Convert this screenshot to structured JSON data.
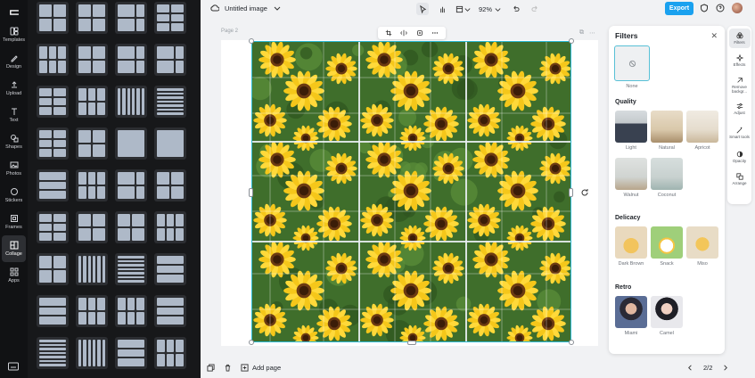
{
  "rail": {
    "items": [
      {
        "label": "Templates",
        "icon": "templates-icon"
      },
      {
        "label": "Design",
        "icon": "design-icon"
      },
      {
        "label": "Upload",
        "icon": "upload-icon"
      },
      {
        "label": "Text",
        "icon": "text-icon"
      },
      {
        "label": "Shapes",
        "icon": "shapes-icon"
      },
      {
        "label": "Photos",
        "icon": "photos-icon"
      },
      {
        "label": "Stickers",
        "icon": "stickers-icon"
      },
      {
        "label": "Frames",
        "icon": "frames-icon"
      },
      {
        "label": "Collage",
        "icon": "collage-icon"
      },
      {
        "label": "Apps",
        "icon": "apps-icon"
      }
    ],
    "active": "Collage"
  },
  "topbar": {
    "doc_title": "Untitled image",
    "zoom": "92%",
    "export_label": "Export"
  },
  "canvas": {
    "page_label": "Page 2"
  },
  "bottombar": {
    "add_page_label": "Add page",
    "page_indicator": "2/2"
  },
  "filters": {
    "title": "Filters",
    "none_label": "None",
    "sections": {
      "quality": {
        "title": "Quality",
        "items": [
          "Light",
          "Natural",
          "Apricot",
          "Walnut",
          "Coconut"
        ]
      },
      "delicacy": {
        "title": "Delicacy",
        "items": [
          "Dark Brown",
          "Snack",
          "Miso"
        ]
      },
      "retro": {
        "title": "Retro",
        "items": [
          "Miami",
          "Camel"
        ]
      }
    }
  },
  "right_rail": {
    "items": [
      "Filters",
      "Effects",
      "Remove backgr...",
      "Adjust",
      "Smart tools",
      "Opacity",
      "Arrange"
    ]
  },
  "colors": {
    "accent": "#1aa1ef",
    "selection": "#2dbbd6",
    "rail_bg": "#111214",
    "panel_bg": "#17181a"
  }
}
